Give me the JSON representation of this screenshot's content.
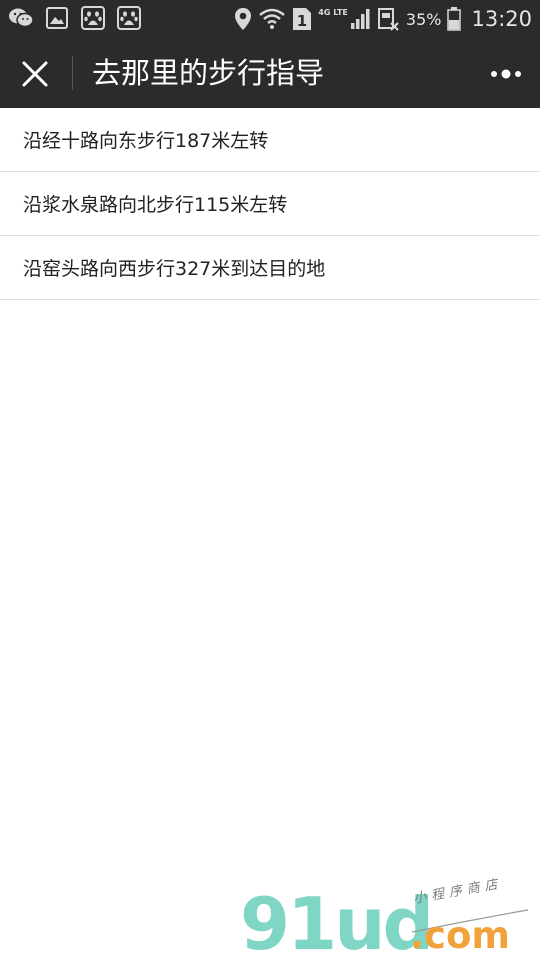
{
  "status_bar": {
    "notifications": [
      "wechat-icon",
      "gallery-icon",
      "baidu-paw-icon",
      "baidu-paw-icon"
    ],
    "network": "4G LTE",
    "sim": "1",
    "battery": "35%",
    "time": "13:20"
  },
  "nav": {
    "title": "去那里的步行指导"
  },
  "steps": [
    "沿经十路向东步行187米左转",
    "沿浆水泉路向北步行115米左转",
    "沿窑头路向西步行327米到达目的地"
  ],
  "watermark": {
    "logo": "91ud",
    "suffix": ".com",
    "tagline": "小程序商店"
  },
  "colors": {
    "bar_background": "#2b2b2d",
    "divider": "#dddddd",
    "logo_teal": "#7fd6c4",
    "logo_orange": "#f1a33a"
  }
}
